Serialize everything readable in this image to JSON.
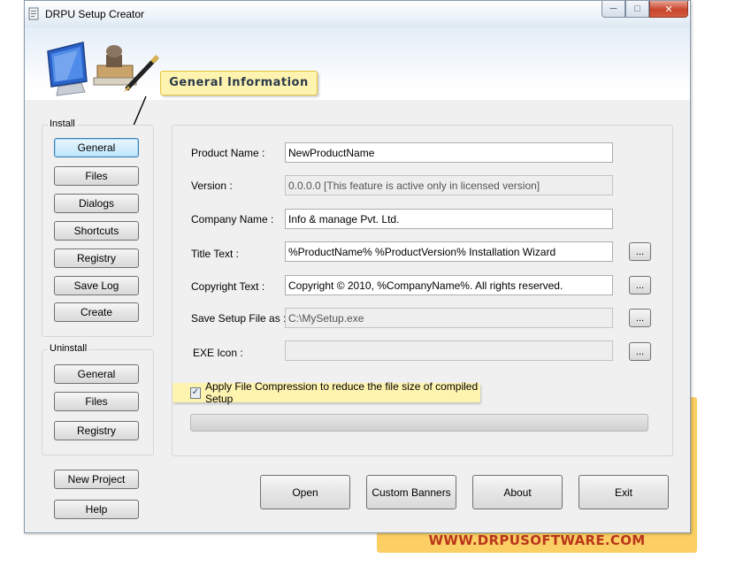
{
  "window": {
    "title": "DRPU Setup Creator"
  },
  "header": {
    "section_title": "General Information"
  },
  "install": {
    "group_label": "Install",
    "buttons": [
      "General",
      "Files",
      "Dialogs",
      "Shortcuts",
      "Registry",
      "Save Log",
      "Create"
    ]
  },
  "uninstall": {
    "group_label": "Uninstall",
    "buttons": [
      "General",
      "Files",
      "Registry"
    ]
  },
  "bottom_left": {
    "new_project": "New Project",
    "help": "Help"
  },
  "form": {
    "product_name": {
      "label": "Product Name :",
      "value": "NewProductName"
    },
    "version": {
      "label": "Version :",
      "value": "0.0.0.0 [This feature is active only in licensed version]"
    },
    "company_name": {
      "label": "Company Name :",
      "value": "Info & manage Pvt. Ltd."
    },
    "title_text": {
      "label": "Title Text :",
      "value": "%ProductName% %ProductVersion% Installation Wizard"
    },
    "copyright_text": {
      "label": "Copyright Text :",
      "value": "Copyright © 2010, %CompanyName%. All rights reserved."
    },
    "save_setup": {
      "label": "Save Setup File as :",
      "value": "C:\\MySetup.exe"
    },
    "exe_icon": {
      "label": "EXE Icon :",
      "value": ""
    },
    "browse_label": "...",
    "compression": {
      "label": "Apply File Compression to reduce the file size of compiled Setup",
      "checked": true,
      "checkmark": "✓"
    }
  },
  "progress": {
    "value": 0
  },
  "actions": {
    "open": "Open",
    "custom_banners": "Custom Banners",
    "about": "About",
    "exit": "Exit"
  },
  "promo": {
    "url": "WWW.DRPUSOFTWARE.COM"
  },
  "colors": {
    "promo_bg": "#fbcf63",
    "promo_text": "#b9361c",
    "title_highlight": "#fff3b0"
  }
}
